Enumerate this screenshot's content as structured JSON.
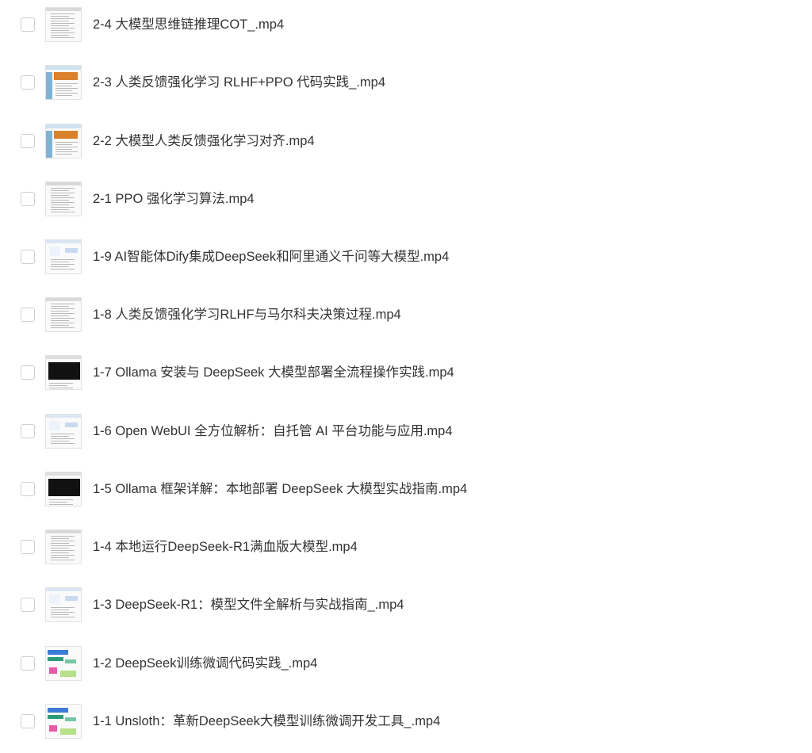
{
  "files": [
    {
      "name": "2-4 大模型思维链推理COT_.mp4",
      "thumb": "doc-thumbnail"
    },
    {
      "name": "2-3 人类反馈强化学习 RLHF+PPO 代码实践_.mp4",
      "thumb": "slide-thumbnail"
    },
    {
      "name": "2-2 大模型人类反馈强化学习对齐.mp4",
      "thumb": "slide-thumbnail"
    },
    {
      "name": "2-1 PPO 强化学习算法.mp4",
      "thumb": "doc-thumbnail"
    },
    {
      "name": "1-9 AI智能体Dify集成DeepSeek和阿里通义千问等大模型.mp4",
      "thumb": "web-thumbnail"
    },
    {
      "name": "1-8 人类反馈强化学习RLHF与马尔科夫决策过程.mp4",
      "thumb": "doc-thumbnail"
    },
    {
      "name": "1-7 Ollama 安装与 DeepSeek 大模型部署全流程操作实践.mp4",
      "thumb": "terminal-thumbnail"
    },
    {
      "name": "1-6 Open WebUI 全方位解析：自托管 AI 平台功能与应用.mp4",
      "thumb": "web-thumbnail"
    },
    {
      "name": "1-5 Ollama 框架详解：本地部署 DeepSeek 大模型实战指南.mp4",
      "thumb": "terminal-thumbnail"
    },
    {
      "name": "1-4 本地运行DeepSeek-R1满血版大模型.mp4",
      "thumb": "doc-thumbnail"
    },
    {
      "name": "1-3 DeepSeek-R1：模型文件全解析与实战指南_.mp4",
      "thumb": "web-thumbnail"
    },
    {
      "name": "1-2 DeepSeek训练微调代码实践_.mp4",
      "thumb": "colorful-thumbnail"
    },
    {
      "name": "1-1 Unsloth：革新DeepSeek大模型训练微调开发工具_.mp4",
      "thumb": "colorful-thumbnail"
    }
  ]
}
